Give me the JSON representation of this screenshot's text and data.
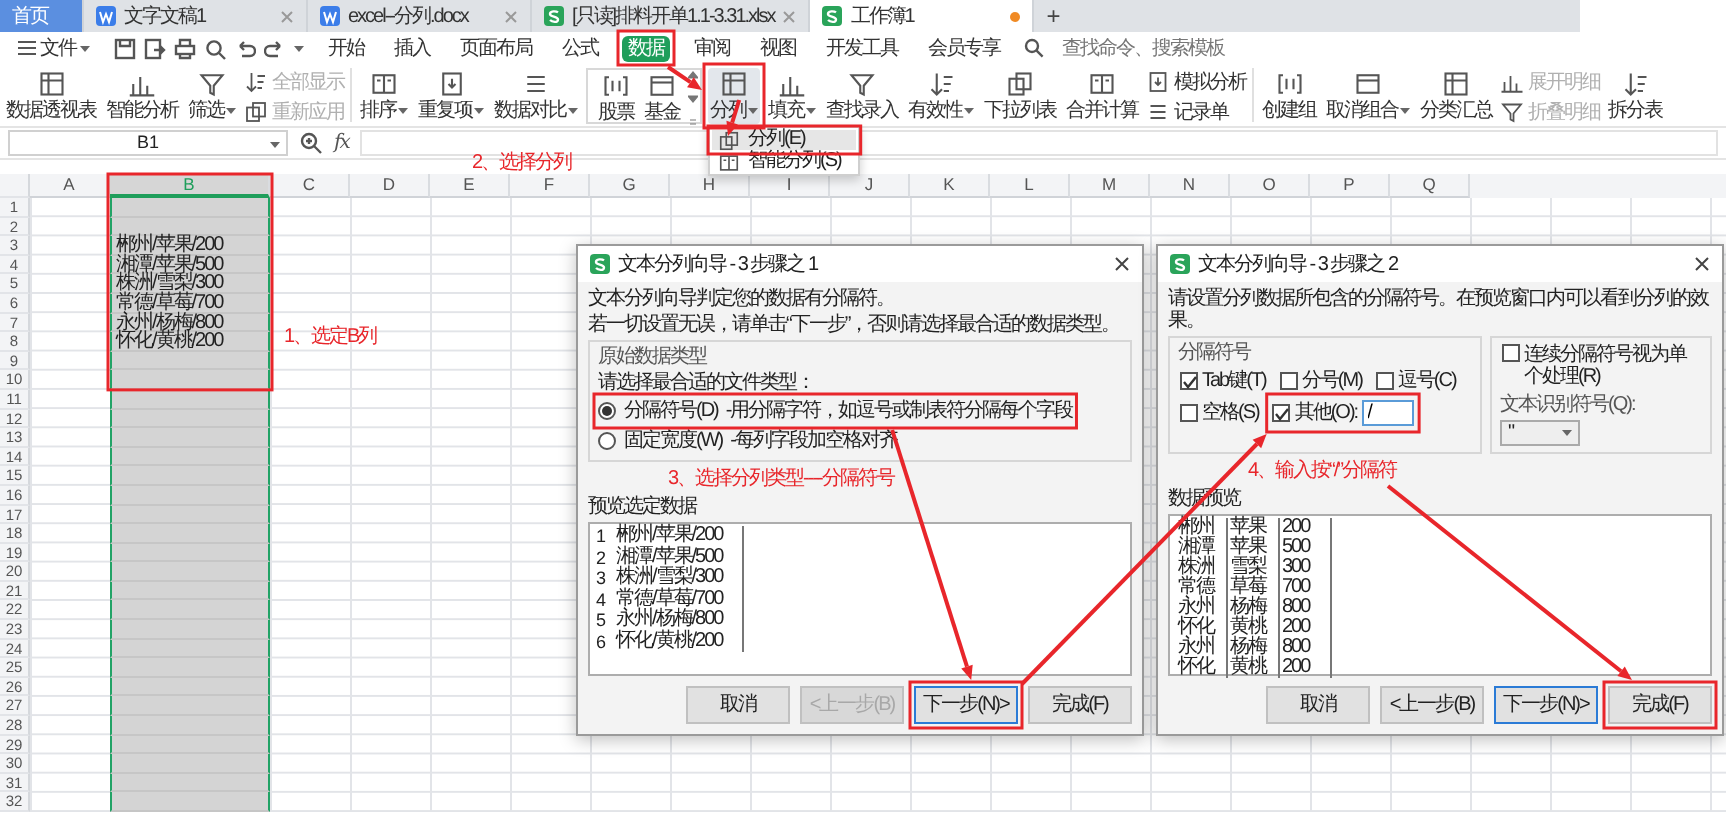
{
  "tab_bar": {
    "tabs": [
      {
        "label": "首页",
        "kind": "home",
        "selected": false
      },
      {
        "label": "文字文稿1",
        "kind": "writer",
        "selected": false
      },
      {
        "label": "excel--分列.docx",
        "kind": "writer",
        "selected": false
      },
      {
        "label": "[只读]排料开单1.1-3.31.xlsx",
        "kind": "sheet",
        "selected": false
      },
      {
        "label": "工作簿1",
        "kind": "sheet",
        "selected": true
      }
    ],
    "new_tab": "+"
  },
  "menu_bar": {
    "file_menu": "文件",
    "items": [
      {
        "label": "开始",
        "selected": false
      },
      {
        "label": "插入",
        "selected": false
      },
      {
        "label": "页面布局",
        "selected": false
      },
      {
        "label": "公式",
        "selected": false
      },
      {
        "label": "数据",
        "selected": true,
        "highlighted": true
      },
      {
        "label": "审阅",
        "selected": false
      },
      {
        "label": "视图",
        "selected": false
      },
      {
        "label": "开发工具",
        "selected": false
      },
      {
        "label": "会员专享",
        "selected": false
      }
    ],
    "search": {
      "placeholder": "查找命令、搜索模板"
    }
  },
  "ribbon": {
    "items": [
      {
        "kind": "large",
        "label": "数据透视表",
        "dropdown": false
      },
      {
        "kind": "large",
        "label": "智能分析",
        "dropdown": false
      },
      {
        "kind": "large",
        "label": "筛选",
        "dropdown": true
      },
      {
        "kind": "stack",
        "items": [
          {
            "label": "全部显示",
            "disabled": true
          },
          {
            "label": "重新应用",
            "disabled": true
          }
        ]
      },
      {
        "kind": "separator"
      },
      {
        "kind": "large",
        "label": "排序",
        "dropdown": true
      },
      {
        "kind": "large",
        "label": "重复项",
        "dropdown": true
      },
      {
        "kind": "large",
        "label": "数据对比",
        "dropdown": true
      },
      {
        "kind": "gallery",
        "items": [
          {
            "label": "股票"
          },
          {
            "label": "基金"
          }
        ]
      },
      {
        "kind": "large",
        "label": "分列",
        "dropdown": true,
        "menu_open": true,
        "highlighted": true
      },
      {
        "kind": "large",
        "label": "填充",
        "dropdown": true
      },
      {
        "kind": "large",
        "label": "查找录入",
        "dropdown": false
      },
      {
        "kind": "large",
        "label": "有效性",
        "dropdown": true
      },
      {
        "kind": "large",
        "label": "下拉列表",
        "dropdown": false
      },
      {
        "kind": "large",
        "label": "合并计算",
        "dropdown": false
      },
      {
        "kind": "stack",
        "items": [
          {
            "label": "模拟分析",
            "disabled": false
          },
          {
            "label": "记录单",
            "disabled": false
          }
        ]
      },
      {
        "kind": "separator"
      },
      {
        "kind": "large",
        "label": "创建组",
        "dropdown": false
      },
      {
        "kind": "large",
        "label": "取消组合",
        "dropdown": true
      },
      {
        "kind": "large",
        "label": "分类汇总",
        "dropdown": false
      },
      {
        "kind": "stack",
        "items": [
          {
            "label": "展开明细",
            "disabled": true
          },
          {
            "label": "折叠明细",
            "disabled": true
          }
        ]
      },
      {
        "kind": "large",
        "label": "拆分表",
        "dropdown": false
      }
    ]
  },
  "split_menu": {
    "items": [
      {
        "label": "分列(E)",
        "selected": true,
        "highlighted": true
      },
      {
        "label": "智能分列(S)",
        "selected": false
      }
    ]
  },
  "formula_bar": {
    "cell_ref": "B1",
    "function_label": "fx"
  },
  "sheet": {
    "columns": [
      {
        "label": "A",
        "selected": false
      },
      {
        "label": "B",
        "selected": true,
        "highlighted": true
      },
      {
        "label": "C",
        "selected": false
      },
      {
        "label": "D",
        "selected": false
      },
      {
        "label": "E",
        "selected": false
      },
      {
        "label": "F",
        "selected": false
      },
      {
        "label": "G",
        "selected": false
      },
      {
        "label": "H",
        "selected": false
      },
      {
        "label": "I",
        "selected": false
      },
      {
        "label": "J",
        "selected": false
      },
      {
        "label": "K",
        "selected": false
      },
      {
        "label": "L",
        "selected": false
      },
      {
        "label": "M",
        "selected": false
      },
      {
        "label": "N",
        "selected": false
      },
      {
        "label": "O",
        "selected": false
      },
      {
        "label": "P",
        "selected": false
      },
      {
        "label": "Q",
        "selected": false
      }
    ],
    "rows": [
      {
        "number": "1"
      },
      {
        "number": "2"
      },
      {
        "number": "3",
        "column_b": "郴州/苹果/200"
      },
      {
        "number": "4",
        "column_b": "湘潭/苹果/500"
      },
      {
        "number": "5",
        "column_b": "株洲/雪梨/300"
      },
      {
        "number": "6",
        "column_b": "常德/草莓/700"
      },
      {
        "number": "7",
        "column_b": "永州/杨梅/800"
      },
      {
        "number": "8",
        "column_b": "怀化/黄桃/200"
      },
      {
        "number": "9"
      },
      {
        "number": "10"
      },
      {
        "number": "11"
      },
      {
        "number": "12"
      },
      {
        "number": "13"
      },
      {
        "number": "14"
      },
      {
        "number": "15"
      },
      {
        "number": "16"
      },
      {
        "number": "17"
      },
      {
        "number": "18"
      },
      {
        "number": "19"
      },
      {
        "number": "20"
      },
      {
        "number": "21"
      },
      {
        "number": "22"
      },
      {
        "number": "23"
      },
      {
        "number": "24"
      },
      {
        "number": "25"
      },
      {
        "number": "26"
      },
      {
        "number": "27"
      },
      {
        "number": "28"
      },
      {
        "number": "29"
      },
      {
        "number": "30"
      },
      {
        "number": "31"
      },
      {
        "number": "32"
      }
    ]
  },
  "annotations": [
    {
      "text": "1、选定B列"
    },
    {
      "text": "2、选择分列"
    }
  ],
  "dialogs": [
    {
      "kind": "type_step",
      "title": "文本分列向导 - 3 步骤之 1",
      "intro": [
        "文本分列向导判定您的数据有分隔符。",
        "若一切设置无误，请单击“下一步”，否则请选择最合适的数据类型。"
      ],
      "group_title": "原始数据类型",
      "prompt": "请选择最合适的文件类型：",
      "options": [
        {
          "label": "分隔符号(D)",
          "description": "-用分隔字符，如逗号或制表符分隔每个字段",
          "selected": true,
          "highlighted": true
        },
        {
          "label": "固定宽度(W)",
          "description": "-每列字段加空格对齐",
          "selected": false
        }
      ],
      "annotation": "3、选择分列类型----分隔符号",
      "preview_title": "预览选定数据",
      "preview_rows": [
        {
          "number": "1",
          "text": "郴州/苹果/200"
        },
        {
          "number": "2",
          "text": "湘潭/苹果/500"
        },
        {
          "number": "3",
          "text": "株洲/雪梨/300"
        },
        {
          "number": "4",
          "text": "常德/草莓/700"
        },
        {
          "number": "5",
          "text": "永州/杨梅/800"
        },
        {
          "number": "6",
          "text": "怀化/黄桃/200"
        }
      ],
      "buttons": [
        {
          "label": "取消",
          "disabled": false,
          "default": false
        },
        {
          "label": "<上一步(B)",
          "disabled": true,
          "default": false
        },
        {
          "label": "下一步(N)>",
          "disabled": false,
          "default": true,
          "highlighted": true
        },
        {
          "label": "完成(F)",
          "disabled": false,
          "default": false
        }
      ]
    },
    {
      "kind": "delimiter_step",
      "title": "文本分列向导 - 3 步骤之 2",
      "intro": [
        "请设置分列数据所包含的分隔符号。在预览窗口内可以看到分列的效果。"
      ],
      "group_title": "分隔符号",
      "delimiters": [
        {
          "label": "Tab键(T)",
          "checked": true
        },
        {
          "label": "分号(M)",
          "checked": false
        },
        {
          "label": "逗号(C)",
          "checked": false
        },
        {
          "label": "空格(S)",
          "checked": false
        },
        {
          "label": "其他(O):",
          "checked": true,
          "value": "/",
          "highlighted": true
        }
      ],
      "consecutive": {
        "label": "连续分隔符号视为单个处理(R)",
        "checked": false
      },
      "qualifier": {
        "label": "文本识别符号(Q):",
        "value": "\""
      },
      "annotation": "4、输入按“/”分隔符",
      "preview_title": "数据预览",
      "preview_rows": [
        [
          "郴州",
          "苹果",
          "200"
        ],
        [
          "湘潭",
          "苹果",
          "500"
        ],
        [
          "株洲",
          "雪梨",
          "300"
        ],
        [
          "常德",
          "草莓",
          "700"
        ],
        [
          "永州",
          "杨梅",
          "800"
        ],
        [
          "怀化",
          "黄桃",
          "200"
        ],
        [
          "永州",
          "杨梅",
          "800"
        ],
        [
          "怀化",
          "黄桃",
          "200"
        ]
      ],
      "buttons": [
        {
          "label": "取消",
          "disabled": false,
          "default": false
        },
        {
          "label": "<上一步(B)",
          "disabled": false,
          "default": false
        },
        {
          "label": "下一步(N)>",
          "disabled": false,
          "default": true
        },
        {
          "label": "完成(F)",
          "disabled": false,
          "default": false,
          "highlighted": true
        }
      ]
    }
  ]
}
